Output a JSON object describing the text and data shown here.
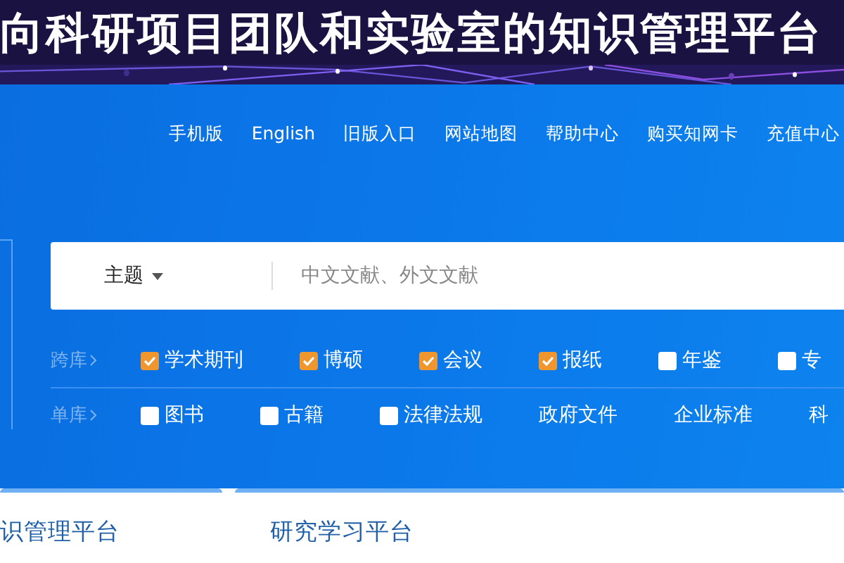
{
  "banner": {
    "title": "向科研项目团队和实验室的知识管理平台"
  },
  "nav": [
    "手机版",
    "English",
    "旧版入口",
    "网站地图",
    "帮助中心",
    "购买知网卡",
    "充值中心"
  ],
  "search": {
    "field": "主题",
    "placeholder": "中文文献、外文文献"
  },
  "rows": [
    {
      "label": "跨库",
      "items": [
        {
          "kind": "check",
          "text": "学术期刊",
          "checked": true
        },
        {
          "kind": "check",
          "text": "博硕",
          "checked": true
        },
        {
          "kind": "check",
          "text": "会议",
          "checked": true
        },
        {
          "kind": "check",
          "text": "报纸",
          "checked": true
        },
        {
          "kind": "check",
          "text": "年鉴",
          "checked": false
        },
        {
          "kind": "check",
          "text": "专",
          "checked": false
        }
      ]
    },
    {
      "label": "单库",
      "items": [
        {
          "kind": "check",
          "text": "图书",
          "checked": false
        },
        {
          "kind": "check",
          "text": "古籍",
          "checked": false
        },
        {
          "kind": "check",
          "text": "法律法规",
          "checked": false
        },
        {
          "kind": "plain",
          "text": "政府文件"
        },
        {
          "kind": "plain",
          "text": "企业标准"
        },
        {
          "kind": "plain",
          "text": "科"
        }
      ]
    }
  ],
  "cards": [
    "识管理平台",
    "研究学习平台"
  ]
}
